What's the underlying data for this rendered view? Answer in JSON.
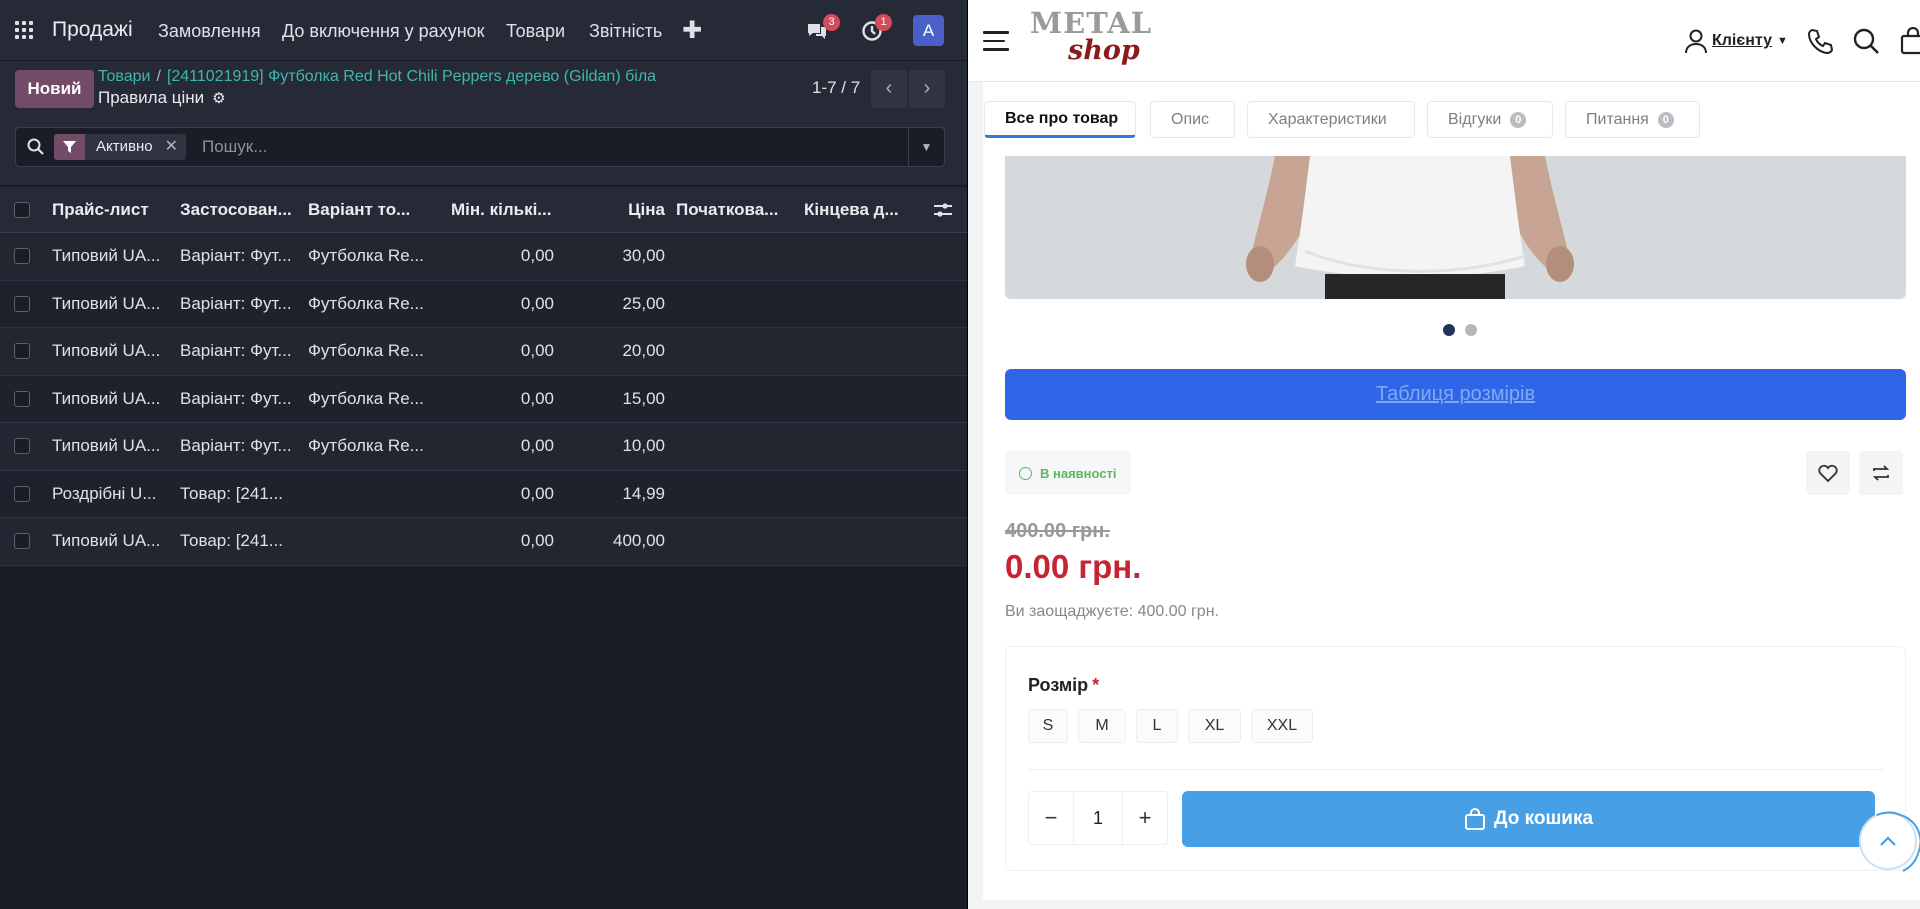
{
  "erp": {
    "brand": "Продажі",
    "menu": [
      "Замовлення",
      "До включення у рахунок",
      "Товари",
      "Звітність"
    ],
    "plus": "✚",
    "chat_badge": "3",
    "activity_badge": "1",
    "avatar_letter": "A",
    "new_button": "Новий",
    "breadcrumb": {
      "parent": "Товари",
      "separator": "/",
      "current": "[2411021919] Футболка Red Hot Chili Peppers дерево (Gildan) біла"
    },
    "subtitle": "Правила ціни",
    "pager": "1-7 / 7",
    "facet_label": "Активно",
    "search_placeholder": "Пошук...",
    "columns": [
      "Прайс-лист",
      "Застосован...",
      "Варіант то...",
      "Мін. кількі...",
      "Ціна",
      "Початкова...",
      "Кінцева д..."
    ],
    "rows": [
      {
        "pricelist": "Типовий UA...",
        "applied": "Варіант: Фут...",
        "variant": "Футболка Re...",
        "min_qty": "0,00",
        "price": "30,00"
      },
      {
        "pricelist": "Типовий UA...",
        "applied": "Варіант: Фут...",
        "variant": "Футболка Re...",
        "min_qty": "0,00",
        "price": "25,00"
      },
      {
        "pricelist": "Типовий UA...",
        "applied": "Варіант: Фут...",
        "variant": "Футболка Re...",
        "min_qty": "0,00",
        "price": "20,00"
      },
      {
        "pricelist": "Типовий UA...",
        "applied": "Варіант: Фут...",
        "variant": "Футболка Re...",
        "min_qty": "0,00",
        "price": "15,00"
      },
      {
        "pricelist": "Типовий UA...",
        "applied": "Варіант: Фут...",
        "variant": "Футболка Re...",
        "min_qty": "0,00",
        "price": "10,00"
      },
      {
        "pricelist": "Роздрібні U...",
        "applied": "Товар: [241...",
        "variant": "",
        "min_qty": "0,00",
        "price": "14,99"
      },
      {
        "pricelist": "Типовий UA...",
        "applied": "Товар: [241...",
        "variant": "",
        "min_qty": "0,00",
        "price": "400,00"
      }
    ]
  },
  "shop": {
    "logo_top": "METAL",
    "logo_bottom": "shop",
    "client_label": "Клієнту",
    "tabs": [
      {
        "label": "Все про товар",
        "count": ""
      },
      {
        "label": "Опис",
        "count": ""
      },
      {
        "label": "Характеристики",
        "count": ""
      },
      {
        "label": "Відгуки",
        "count": "0"
      },
      {
        "label": "Питання",
        "count": "0"
      }
    ],
    "size_table_button": "Таблиця розмірів",
    "stock_status": "В наявності",
    "old_price": "400.00 грн.",
    "new_price": "0.00 грн.",
    "savings": "Ви заощаджуєте: 400.00 грн.",
    "size_label": "Розмір",
    "required_mark": "*",
    "sizes": [
      "S",
      "M",
      "L",
      "XL",
      "XXL"
    ],
    "quantity": "1",
    "qty_minus": "−",
    "qty_plus": "+",
    "add_to_cart": "До кошика"
  },
  "colors": {
    "erp_accent": "#714b67",
    "erp_link": "#3fb7ad",
    "price_red": "#c82333",
    "primary_blue": "#2f66e8",
    "cart_blue": "#47a0e6",
    "stock_green": "#5cb85c"
  }
}
